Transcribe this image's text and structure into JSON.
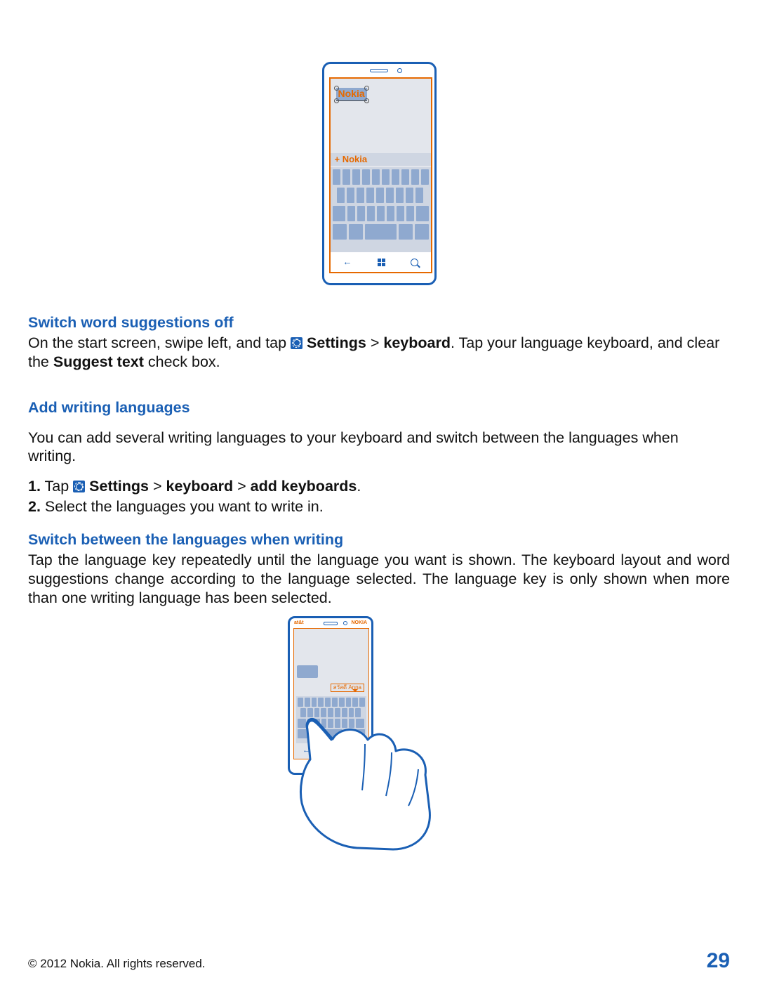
{
  "figure1": {
    "selected_word": "Nokia",
    "suggestion": "+ Nokia"
  },
  "figure2": {
    "status_left": "at&t",
    "status_right": "NOKIA",
    "suggestion": "สวัสดี Anna"
  },
  "sections": {
    "switch_off_heading": "Switch word suggestions off",
    "switch_off_p1a": "On the start screen, swipe left, and tap ",
    "switch_off_p1b": " Settings",
    "switch_off_p1c": " > ",
    "switch_off_p1d": "keyboard",
    "switch_off_p1e": ". Tap your language keyboard, and clear the ",
    "switch_off_p1f": "Suggest text",
    "switch_off_p1g": " check box.",
    "add_lang_heading": "Add writing languages",
    "add_lang_p1": "You can add several writing languages to your keyboard and switch between the languages when writing.",
    "step1a": "1.",
    "step1b": " Tap ",
    "step1c": " Settings",
    "step1d": " > ",
    "step1e": "keyboard",
    "step1f": " > ",
    "step1g": "add keyboards",
    "step1h": ".",
    "step2a": "2.",
    "step2b": " Select the languages you want to write in.",
    "switch_lang_heading": "Switch between the languages when writing",
    "switch_lang_p1": "Tap the language key repeatedly until the language you want is shown. The keyboard layout and word suggestions change according to the language selected. The language key is only shown when more than one writing language has been selected."
  },
  "footer": {
    "copyright": "© 2012 Nokia. All rights reserved.",
    "page": "29"
  }
}
